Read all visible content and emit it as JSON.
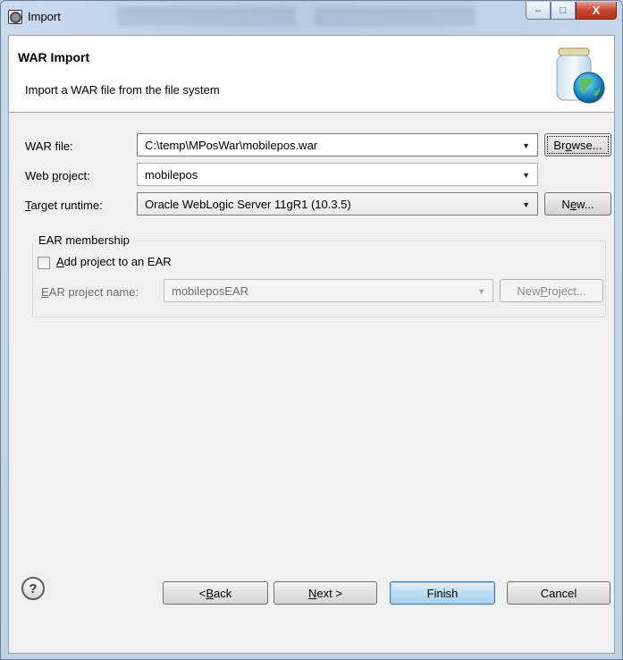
{
  "window": {
    "title": "Import",
    "min_glyph": "–",
    "max_glyph": "□",
    "close_glyph": "X"
  },
  "banner": {
    "title": "WAR Import",
    "description": "Import a WAR file from the file system",
    "icon": "jar-globe-icon"
  },
  "form": {
    "war_file": {
      "label": "WAR file:",
      "value": "C:\\temp\\MPosWar\\mobilepos.war",
      "button": {
        "pre": "Br",
        "mn": "o",
        "post": "wse..."
      }
    },
    "web_project": {
      "label_pre": "Web ",
      "label_mn": "p",
      "label_post": "roject:",
      "value": "mobilepos"
    },
    "target_runtime": {
      "label_mn": "T",
      "label_post": "arget runtime:",
      "value": "Oracle WebLogic Server 11gR1 (10.3.5)",
      "button": {
        "pre": "N",
        "mn": "e",
        "post": "w..."
      }
    }
  },
  "ear": {
    "group_title": "EAR membership",
    "checkbox": {
      "mn": "A",
      "post": "dd project to an EAR",
      "checked": false
    },
    "name_label": {
      "mn": "E",
      "post": "AR project name:"
    },
    "name_value": "mobileposEAR",
    "new_project_button": {
      "pre": "New ",
      "mn": "P",
      "post": "roject..."
    }
  },
  "footer": {
    "help": "?",
    "back": {
      "pre": "< ",
      "mn": "B",
      "post": "ack"
    },
    "next": {
      "mn": "N",
      "post": "ext >"
    },
    "finish": "Finish",
    "cancel": "Cancel"
  },
  "arrow_glyph": "▼",
  "colors": {
    "banner_bg": "#ffffff",
    "dialog_bg": "#f0f0f0",
    "default_button": "#a7d1ee",
    "close_button": "#c8452d"
  }
}
